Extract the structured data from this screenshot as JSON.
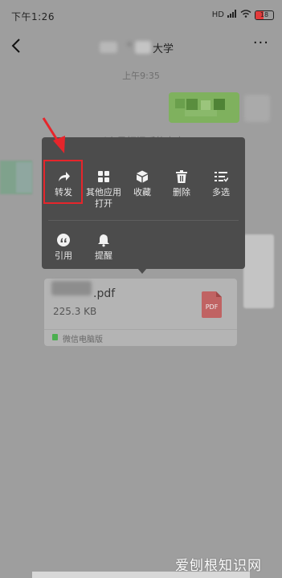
{
  "status_bar": {
    "time": "下午1:26",
    "battery": "18",
    "network": "HD"
  },
  "nav": {
    "title": "大学",
    "more": "···"
  },
  "chat": {
    "timestamp": "上午9:35",
    "system_message": "以上是打招呼的内容"
  },
  "context_menu": {
    "row1": [
      {
        "label": "转发",
        "icon": "forward-icon"
      },
      {
        "label": "其他应用",
        "label2": "打开",
        "icon": "grid-icon"
      },
      {
        "label": "收藏",
        "icon": "cube-icon"
      },
      {
        "label": "删除",
        "icon": "trash-icon"
      },
      {
        "label": "多选",
        "icon": "list-icon"
      }
    ],
    "row2": [
      {
        "label": "引用",
        "icon": "quote-icon"
      },
      {
        "label": "提醒",
        "icon": "bell-icon"
      }
    ]
  },
  "file_card": {
    "name_suffix": ".pdf",
    "size": "225.3 KB",
    "type_badge": "PDF",
    "source": "微信电脑版"
  },
  "watermark": "爱刨根知识网",
  "colors": {
    "highlight_border": "#e6252b",
    "menu_bg": "#4c4c4c",
    "pdf_icon": "#c06363"
  }
}
